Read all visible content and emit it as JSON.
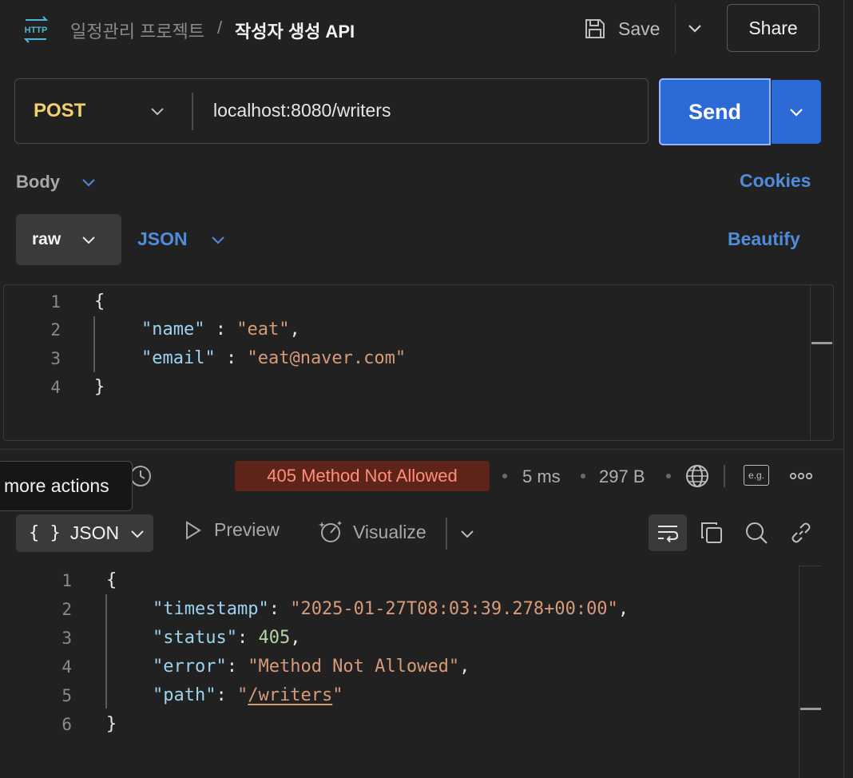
{
  "header": {
    "breadcrumb_parent": "일정관리 프로젝트",
    "breadcrumb_separator": "/",
    "title": "작성자 생성 API",
    "save_label": "Save",
    "share_label": "Share"
  },
  "request": {
    "method": "POST",
    "url": "localhost:8080/writers",
    "send_label": "Send"
  },
  "body_section": {
    "body_label": "Body",
    "cookies_label": "Cookies",
    "mode_label": "raw",
    "type_label": "JSON",
    "beautify_label": "Beautify",
    "editor": {
      "line_numbers": [
        "1",
        "2",
        "3",
        "4"
      ],
      "lines": [
        {
          "open": "{"
        },
        {
          "key": "\"name\"",
          "sep": " : ",
          "value": "\"eat\"",
          "end": ","
        },
        {
          "key": "\"email\"",
          "sep": " : ",
          "value": "\"eat@naver.com\"",
          "end": ""
        },
        {
          "close": "}"
        }
      ]
    }
  },
  "response": {
    "tooltip": "more actions",
    "status": "405 Method Not Allowed",
    "status_color": "#5e2419",
    "time": "5 ms",
    "size": "297 B",
    "eg_label": "e.g.",
    "format_label": "JSON",
    "format_icon": "{ }",
    "preview_label": "Preview",
    "visualize_label": "Visualize",
    "editor": {
      "line_numbers": [
        "1",
        "2",
        "3",
        "4",
        "5",
        "6"
      ],
      "lines": [
        {
          "open": "{"
        },
        {
          "key": "\"timestamp\"",
          "sep": ": ",
          "value": "\"2025-01-27T08:03:39.278+00:00\"",
          "end": ","
        },
        {
          "key": "\"status\"",
          "sep": ": ",
          "value": "405",
          "end": ","
        },
        {
          "key": "\"error\"",
          "sep": ": ",
          "value": "\"Method Not Allowed\"",
          "end": ","
        },
        {
          "key": "\"path\"",
          "sep": ": ",
          "quote_open": "\"",
          "value": "/writers",
          "quote_close": "\"",
          "end": ""
        },
        {
          "close": "}"
        }
      ]
    }
  },
  "icons": {
    "app": "http-icon",
    "save": "save-icon",
    "history": "history-icon",
    "globe": "globe-icon",
    "more": "more-horizontal-icon",
    "wrap": "wrap-lines-icon",
    "copy": "copy-icon",
    "search": "search-icon",
    "link": "link-icon"
  },
  "colors": {
    "accent": "#2c6bd6",
    "link": "#4f8ddc",
    "method": "#f2d06b",
    "json_key": "#9cd3f0",
    "json_string": "#d79b7a",
    "json_number": "#b5d3a8"
  }
}
